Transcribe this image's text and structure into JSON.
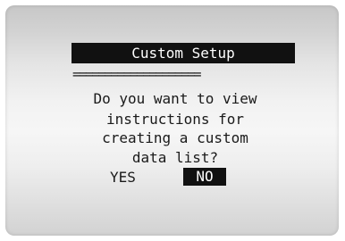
{
  "header": {
    "title": "Custom Setup",
    "divider": "===================="
  },
  "prompt": {
    "lines": [
      "Do you want to view",
      "instructions for",
      "creating a custom",
      "data list?"
    ]
  },
  "options": {
    "yes_label": "YES",
    "no_label": "NO",
    "selected": "NO"
  },
  "colors": {
    "lcd_text": "#1a1a1a",
    "highlight_bg": "#111111",
    "highlight_text": "#ffffff"
  }
}
